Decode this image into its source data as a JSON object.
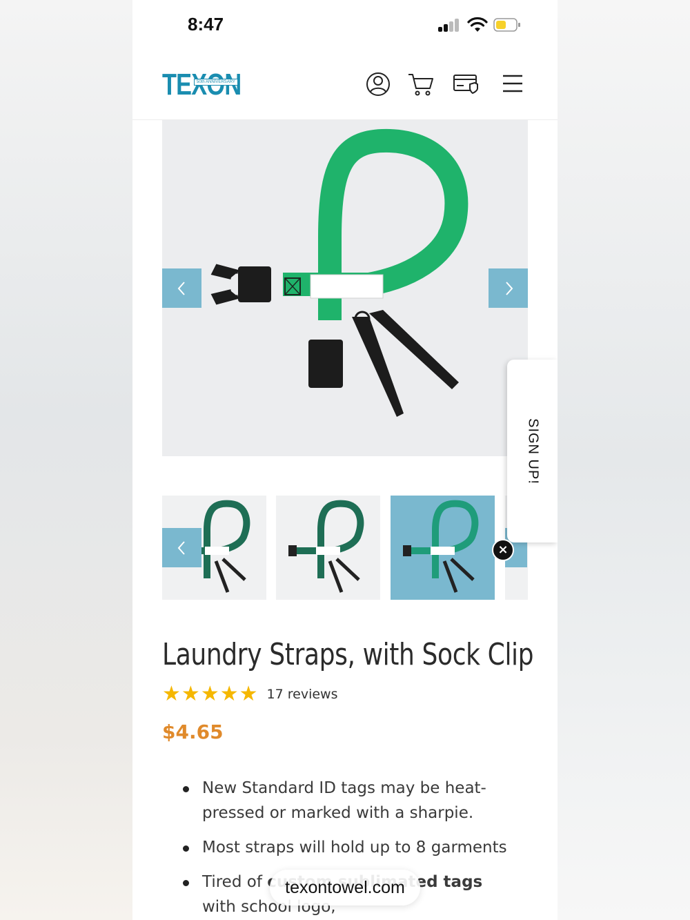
{
  "status_bar": {
    "time": "8:47"
  },
  "header": {
    "logo_text": "TEXON",
    "logo_badge": "50th ANNIVERSARY",
    "icons": [
      "account-icon",
      "cart-icon",
      "payment-card-icon",
      "menu-icon"
    ]
  },
  "gallery": {
    "thumbnail_count": 4,
    "active_thumbnail": 3,
    "colors": {
      "arrow_bg": "#7ab8cf",
      "strap_green": "#1fb36b",
      "active_thumb_bg": "#7ab8cf"
    }
  },
  "signup_tab": {
    "label": "SIGN UP!"
  },
  "product": {
    "title": "Laundry Straps, with Sock Clip",
    "rating_stars": 5,
    "reviews": "17 reviews",
    "price": "$4.65",
    "bullets": [
      {
        "text": "New Standard ID tags may be heat-pressed or marked with a sharpie."
      },
      {
        "text": "Most straps will hold up to 8 garments"
      },
      {
        "prefix": "Tired of ",
        "bold": "custom sublimated tags",
        "suffix": " with school logo,"
      }
    ]
  },
  "browser": {
    "url": "texontowel.com"
  },
  "colors": {
    "brand": "#1a8db0",
    "price": "#e08a2b",
    "star": "#f5b700"
  }
}
